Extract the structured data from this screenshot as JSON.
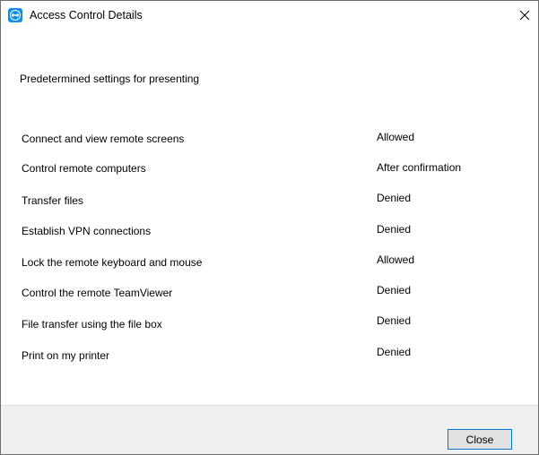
{
  "window": {
    "title": "Access Control Details",
    "icon": "teamviewer-logo-icon"
  },
  "subtitle": "Predetermined settings for presenting",
  "settings": [
    {
      "label": "Connect and view remote screens",
      "value": "Allowed"
    },
    {
      "label": "Control remote computers",
      "value": "After confirmation"
    },
    {
      "label": "Transfer files",
      "value": "Denied"
    },
    {
      "label": "Establish VPN connections",
      "value": "Denied"
    },
    {
      "label": "Lock the remote keyboard and mouse",
      "value": "Allowed"
    },
    {
      "label": "Control the remote TeamViewer",
      "value": "Denied"
    },
    {
      "label": "File transfer using the file box",
      "value": "Denied"
    },
    {
      "label": "Print on my printer",
      "value": "Denied"
    }
  ],
  "footer": {
    "close_label": "Close"
  },
  "colors": {
    "accent": "#0e8ee9",
    "button_border": "#0078d7",
    "footer_bg": "#f0f0f0"
  }
}
